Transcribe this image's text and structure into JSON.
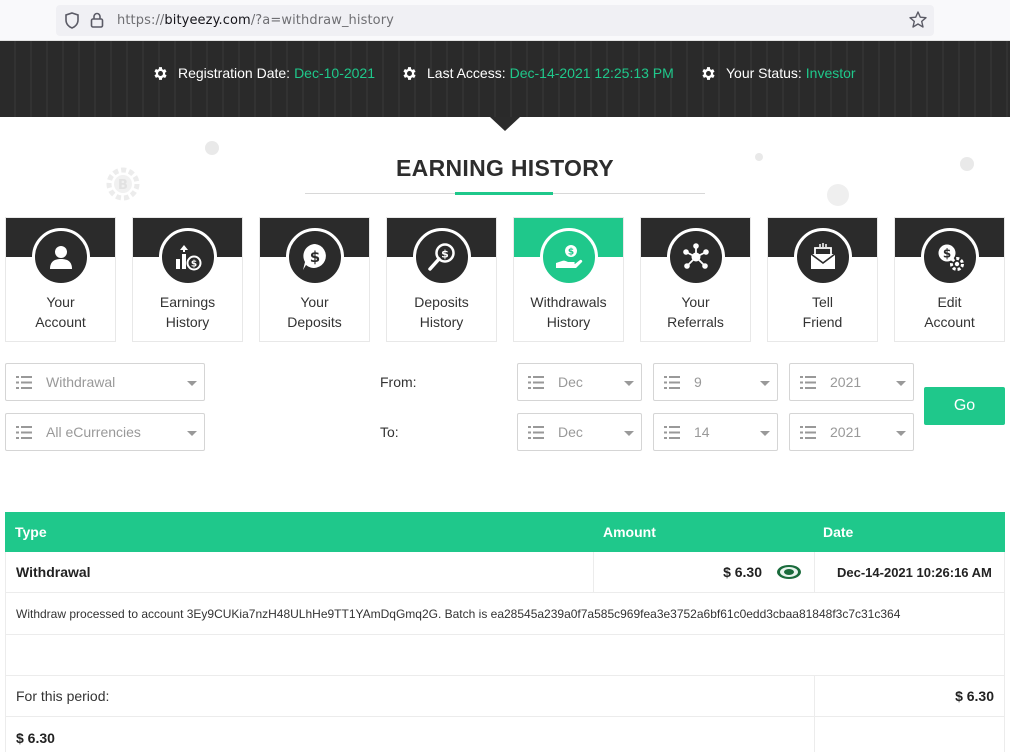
{
  "browser": {
    "url_prefix": "https://",
    "url_domain": "bityeezy.com",
    "url_path": "/?a=withdraw_history"
  },
  "header": {
    "registration_label": "Registration Date:",
    "registration_value": "Dec-10-2021",
    "access_label": "Last Access:",
    "access_value": "Dec-14-2021 12:25:13 PM",
    "status_label": "Your Status:",
    "status_value": "Investor"
  },
  "page": {
    "title": "EARNING HISTORY"
  },
  "nav": [
    {
      "line1": "Your",
      "line2": "Account",
      "icon": "user-icon"
    },
    {
      "line1": "Earnings",
      "line2": "History",
      "icon": "chart-dollar-icon"
    },
    {
      "line1": "Your",
      "line2": "Deposits",
      "icon": "dollar-bubble-icon"
    },
    {
      "line1": "Deposits",
      "line2": "History",
      "icon": "search-dollar-icon"
    },
    {
      "line1": "Withdrawals",
      "line2": "History",
      "icon": "hand-coin-icon"
    },
    {
      "line1": "Your",
      "line2": "Referrals",
      "icon": "network-icon"
    },
    {
      "line1": "Tell",
      "line2": "Friend",
      "icon": "envelope-icon"
    },
    {
      "line1": "Edit",
      "line2": "Account",
      "icon": "dollar-gear-icon"
    }
  ],
  "filters": {
    "type": "Withdrawal",
    "currency": "All eCurrencies",
    "from_label": "From:",
    "to_label": "To:",
    "from_month": "Dec",
    "from_day": "9",
    "from_year": "2021",
    "to_month": "Dec",
    "to_day": "14",
    "to_year": "2021",
    "go_label": "Go"
  },
  "table": {
    "headers": {
      "type": "Type",
      "amount": "Amount",
      "date": "Date"
    },
    "rows": [
      {
        "type": "Withdrawal",
        "amount": "$ 6.30",
        "date": "Dec-14-2021 10:26:16 AM",
        "detail": "Withdraw processed to account 3Ey9CUKia7nzH48ULhHe9TT1YAmDqGmq2G. Batch is ea28545a239a0f7a585c969fea3e3752a6bf61c0edd3cbaa81848f3c7c31c364"
      }
    ],
    "period_label": "For this period:",
    "period_total": "$ 6.30",
    "grand_total": "$ 6.30"
  },
  "colors": {
    "accent": "#1fc88b",
    "dark": "#2b2b2b"
  }
}
